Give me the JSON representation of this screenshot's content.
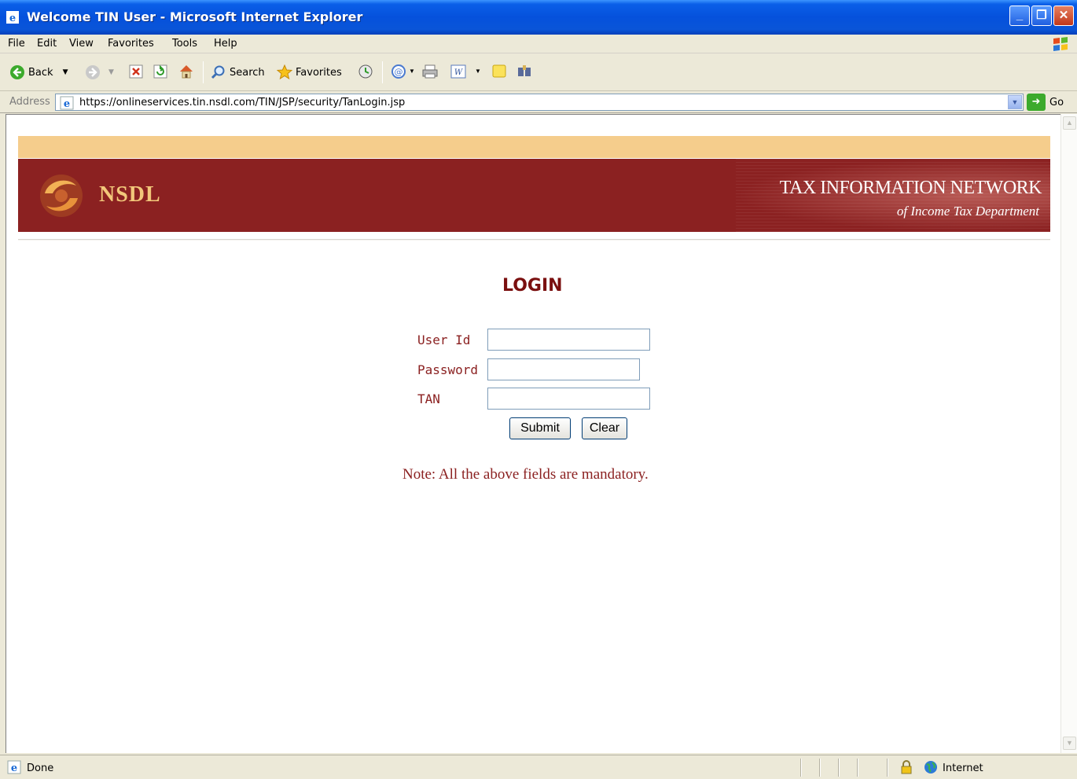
{
  "window": {
    "title": "Welcome TIN User - Microsoft Internet Explorer",
    "controls": [
      "minimize",
      "maximize",
      "close"
    ]
  },
  "menu": {
    "items": [
      "File",
      "Edit",
      "View",
      "Favorites",
      "Tools",
      "Help"
    ]
  },
  "toolbar": {
    "back_label": "Back",
    "search_label": "Search",
    "favorites_label": "Favorites"
  },
  "address": {
    "label": "Address",
    "url": "https://onlineservices.tin.nsdl.com/TIN/JSP/security/TanLogin.jsp",
    "go_label": "Go"
  },
  "header": {
    "logo_text": "NSDL",
    "title": "TAX INFORMATION NETWORK",
    "subtitle": "of Income Tax Department",
    "band_color": "#f5cd8c",
    "banner_color": "#8b2121"
  },
  "login": {
    "heading": "LOGIN",
    "user_id_label": "User Id",
    "user_id_value": "",
    "password_label": "Password",
    "password_value": "",
    "tan_label": "TAN",
    "tan_value": "",
    "submit_label": "Submit",
    "clear_label": "Clear",
    "note": "Note: All the above fields are mandatory."
  },
  "status": {
    "text": "Done",
    "zone": "Internet"
  }
}
